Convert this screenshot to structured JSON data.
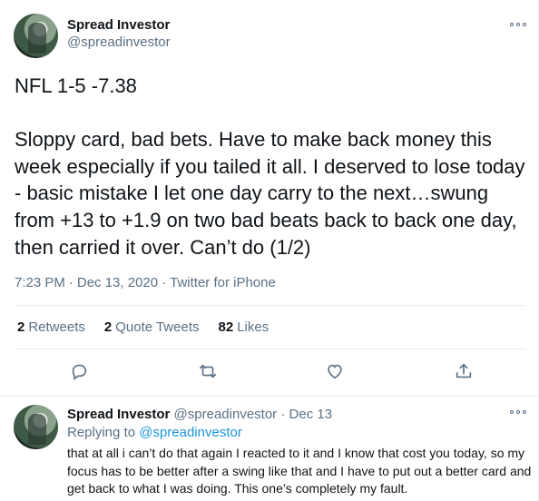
{
  "tweet": {
    "author": {
      "display_name": "Spread Investor",
      "handle": "@spreadinvestor"
    },
    "text": "NFL 1-5 -7.38\n\nSloppy card, bad bets. Have to make back money this week especially if you tailed it all. I deserved to lose today - basic mistake I let one day carry to the next…swung from +13 to +1.9 on two bad beats back to back one day, then carried it over. Can’t do (1/2)",
    "time": "7:23 PM",
    "date": "Dec 13, 2020",
    "separator": "·",
    "source": "Twitter for iPhone",
    "stats": [
      {
        "count": "2",
        "label": "Retweets"
      },
      {
        "count": "2",
        "label": "Quote Tweets"
      },
      {
        "count": "82",
        "label": "Likes"
      }
    ],
    "actions": [
      "reply-icon",
      "retweet-icon",
      "like-icon",
      "share-icon"
    ]
  },
  "reply": {
    "author": {
      "display_name": "Spread Investor",
      "handle": "@spreadinvestor"
    },
    "separator": "·",
    "date": "Dec 13",
    "replying_prefix": "Replying to",
    "replying_to": "@spreadinvestor",
    "text": "that at all i can’t do that again I reacted to it and I know that cost you today, so my focus has to be better after a swing like that and I have to put out a better card and get back to what I was doing. This one’s completely my fault."
  },
  "colors": {
    "text": "#0f1419",
    "secondary": "#5b7083",
    "link": "#1b95e0",
    "border": "#e6ecf0"
  }
}
